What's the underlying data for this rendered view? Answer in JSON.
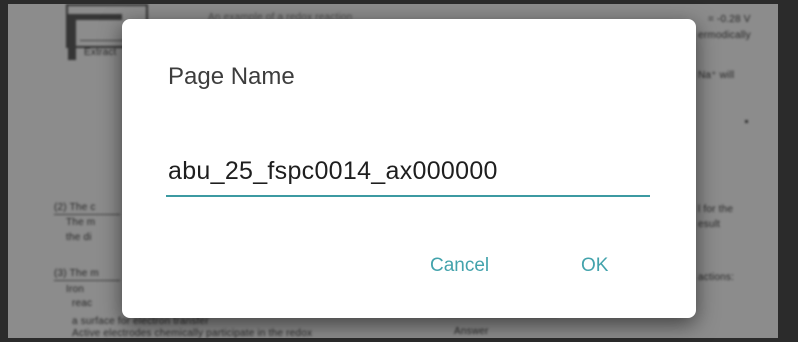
{
  "background_document": {
    "left_snippets": [
      "Extract",
      "(2)  The c",
      "The m",
      "the di",
      "(3)  The m",
      "Iron",
      "reac",
      "a surface for electron transfer",
      "Active electrodes chemically participate in the redox"
    ],
    "top_snippets": [
      "An example of a redox reaction",
      "= -0.28 V",
      "ermodically"
    ],
    "right_snippets": [
      "Na⁺ will",
      "l for the",
      "esult",
      "actions:"
    ],
    "bottom_snippets": [
      "Answer"
    ]
  },
  "dialog": {
    "title": "Page Name",
    "page_name_value": "abu_25_fspc0014_ax000000",
    "cancel_label": "Cancel",
    "ok_label": "OK",
    "accent_color": "#43a3ac"
  }
}
